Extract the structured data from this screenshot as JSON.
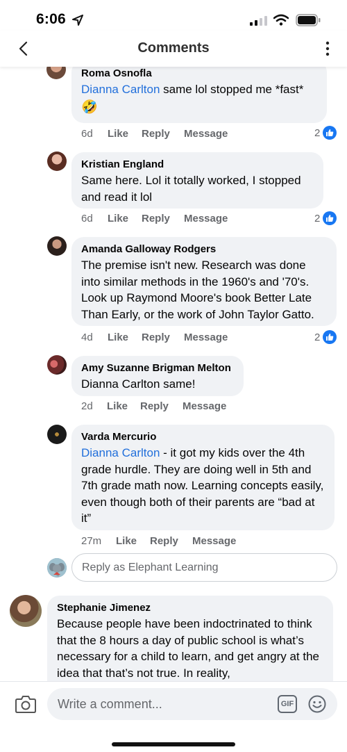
{
  "status_bar": {
    "time": "6:06"
  },
  "header": {
    "title": "Comments"
  },
  "comments": [
    {
      "author": "Roma Osnofla",
      "mention": "Dianna Carlton",
      "text": " same lol stopped me *fast*",
      "emoji": "🤣",
      "time": "6d",
      "like": "Like",
      "reply": "Reply",
      "message": "Message",
      "reactions": "2"
    },
    {
      "author": "Kristian England",
      "text": "Same here. Lol it totally worked, I stopped and read it lol",
      "time": "6d",
      "like": "Like",
      "reply": "Reply",
      "message": "Message",
      "reactions": "2"
    },
    {
      "author": "Amanda Galloway Rodgers",
      "text": "The premise isn't new. Research was done into similar methods in the 1960's and '70's. Look up Raymond Moore's book Better Late Than Early, or the work of John Taylor Gatto.",
      "time": "4d",
      "like": "Like",
      "reply": "Reply",
      "message": "Message",
      "reactions": "2"
    },
    {
      "author": "Amy Suzanne Brigman Melton",
      "text": "Dianna Carlton same!",
      "time": "2d",
      "like": "Like",
      "reply": "Reply",
      "message": "Message"
    },
    {
      "author": "Varda Mercurio",
      "mention": "Dianna Carlton",
      "text": " - it got my kids over the 4th grade hurdle. They are doing well in 5th and 7th grade math now. Learning concepts easily, even though both of their parents are “bad at it”",
      "time": "27m",
      "like": "Like",
      "reply": "Reply",
      "message": "Message"
    },
    {
      "author": "Stephanie Jimenez",
      "text": "Because people have been indoctrinated to think that the 8 hours a day of public school is what’s necessary for a child to learn, and get angry at the idea that that’s not true.  In reality,"
    }
  ],
  "reply_input": {
    "placeholder": "Reply as Elephant Learning"
  },
  "composer": {
    "placeholder": "Write a comment...",
    "gif_label": "GIF"
  },
  "icons": [
    "location-arrow-icon",
    "signal-icon",
    "wifi-icon",
    "battery-icon",
    "back-chevron-icon",
    "more-dots-icon",
    "like-thumb-icon",
    "camera-icon",
    "gif-icon",
    "emoji-icon"
  ],
  "colors": {
    "mention": "#216fdb",
    "like_badge": "#1877f2",
    "bubble": "#f0f2f5",
    "meta": "#65676b"
  }
}
